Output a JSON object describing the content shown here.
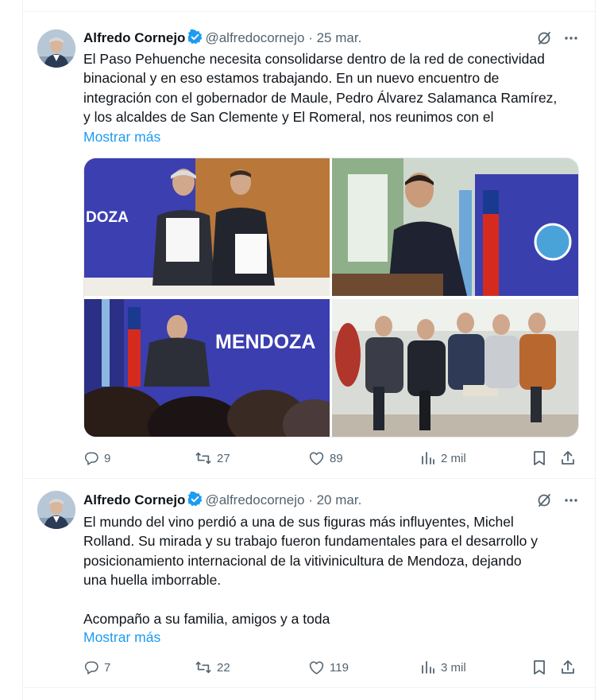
{
  "tweets": [
    {
      "author": "Alfredo Cornejo",
      "handle": "@alfredocornejo",
      "separator": "·",
      "date": "25 mar.",
      "lines": [
        "El Paso Pehuenche necesita consolidarse dentro de la red de conectividad",
        "binacional y en eso estamos trabajando. En un nuevo encuentro de",
        "integración con el gobernador de Maule, Pedro Álvarez Salamanca Ramírez,",
        "y los alcaldes de San Clemente y El Romeral, nos reunimos con el"
      ],
      "show_more": "Mostrar más",
      "media_text": {
        "banner_1": "DOZA",
        "banner_3": "MENDOZA"
      },
      "stats": {
        "replies": "9",
        "reposts": "27",
        "likes": "89",
        "views": "2 mil"
      }
    },
    {
      "author": "Alfredo Cornejo",
      "handle": "@alfredocornejo",
      "separator": "·",
      "date": "20 mar.",
      "lines": [
        "El mundo del vino perdió a una de sus figuras más influyentes, Michel",
        "Rolland. Su mirada y su trabajo fueron fundamentales para el desarrollo y",
        "posicionamiento internacional de la vitivinicultura de Mendoza, dejando",
        "una huella imborrable.",
        "",
        "Acompaño a su familia, amigos y a toda"
      ],
      "show_more": "Mostrar más",
      "stats": {
        "replies": "7",
        "reposts": "22",
        "likes": "119",
        "views": "3 mil"
      }
    }
  ],
  "colors": {
    "accent": "#1d9bf0",
    "text": "#0f1419",
    "secondary": "#536471",
    "border": "#eff3f4",
    "banner_blue": "#3b3fb0"
  },
  "icons": [
    "verified-badge-icon",
    "grok-icon",
    "more-icon",
    "reply-icon",
    "repost-icon",
    "like-icon",
    "views-icon",
    "bookmark-icon",
    "share-icon"
  ]
}
